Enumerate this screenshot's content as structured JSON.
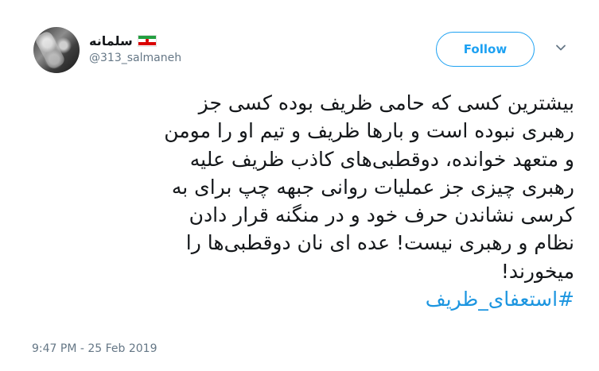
{
  "author": {
    "display_name": "سلمانه",
    "handle": "@313_salmaneh",
    "flag_icon": "iran-flag-icon"
  },
  "follow_button": {
    "label": "Follow"
  },
  "menu_icon": "chevron-down-icon",
  "tweet": {
    "lines": [
      "بیشترین کسی که حامی ظریف بوده کسی جز",
      "رهبری نبوده است و بارها ظریف و تیم او را مومن",
      "و متعهد خوانده، دوقطبی‌های کاذب ظریف علیه",
      "رهبری چیزی جز عملیات روانی جبهه چپ برای به",
      "کرسی نشاندن حرف خود و در منگنه قرار دادن",
      "نظام و رهبری نیست! عده ای نان دوقطبی‌ها را",
      "میخورند!"
    ],
    "hashtag": "#استعفای_ظریف"
  },
  "timestamp": "9:47 PM - 25 Feb 2019",
  "colors": {
    "accent": "#1da1f2",
    "link": "#1b95e0",
    "secondary_text": "#657786",
    "primary_text": "#14171a"
  }
}
